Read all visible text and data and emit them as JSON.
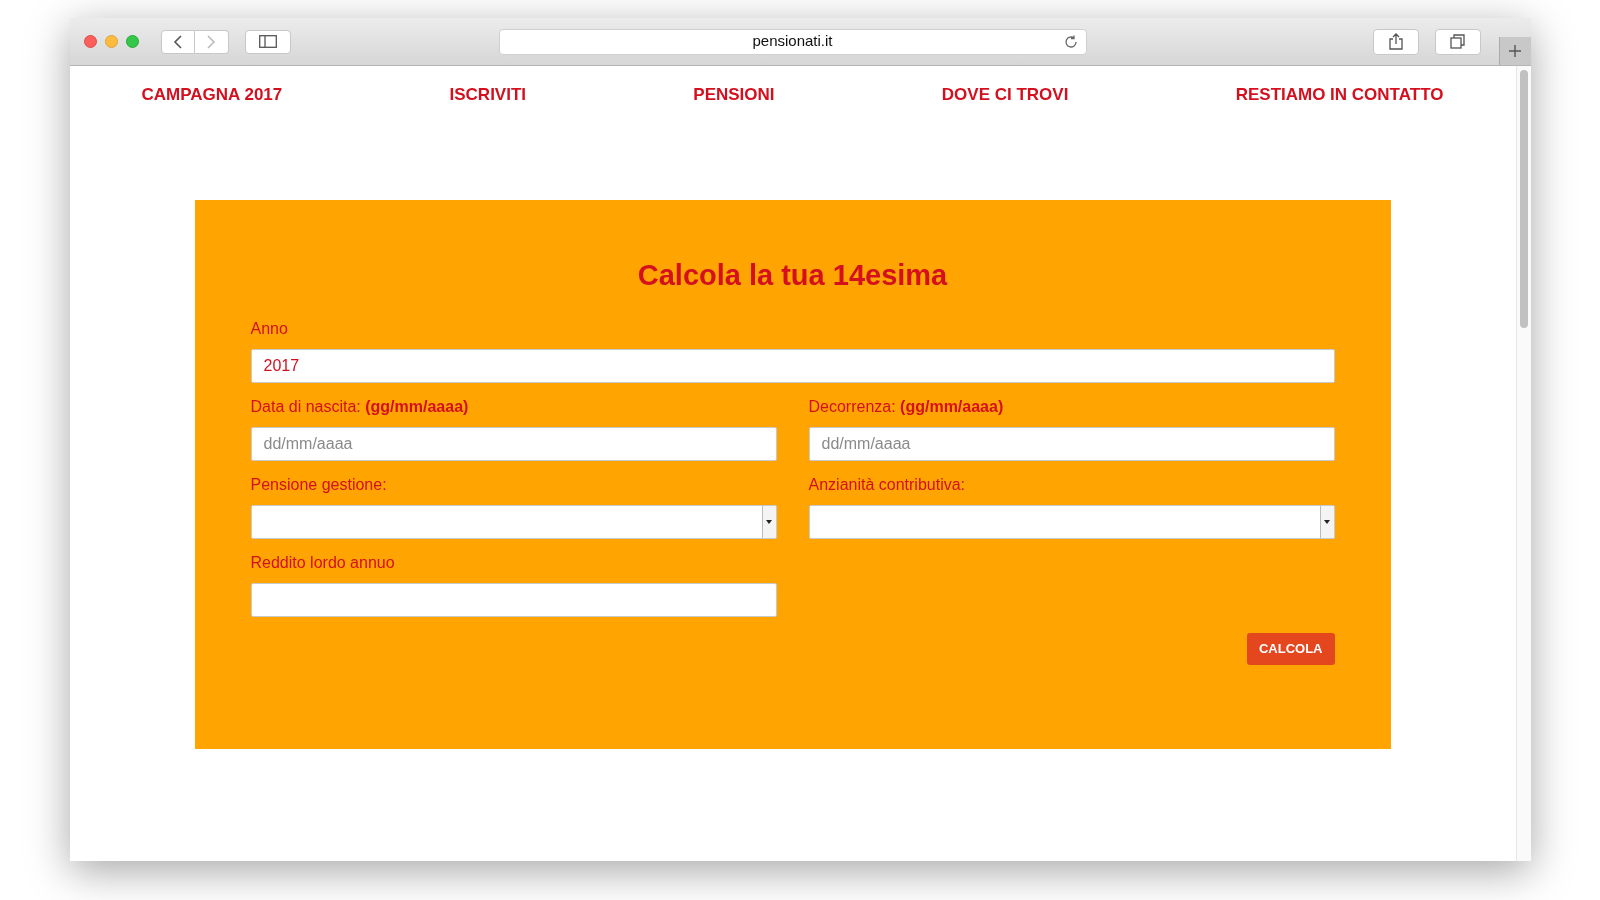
{
  "browser": {
    "url": "pensionati.it"
  },
  "nav": [
    "CAMPAGNA 2017",
    "ISCRIVITI",
    "PENSIONI",
    "DOVE CI TROVI",
    "RESTIAMO IN CONTATTO"
  ],
  "form": {
    "title": "Calcola la tua 14esima",
    "rows": [
      [
        {
          "kind": "text",
          "label": "Anno",
          "value": "2017"
        }
      ],
      [
        {
          "kind": "text",
          "label": "Data di nascita: **(gg/mm/aaaa)**",
          "placeholder": "dd/mm/aaaa"
        },
        {
          "kind": "text",
          "label": "Decorrenza: **(gg/mm/aaaa)**",
          "placeholder": "dd/mm/aaaa"
        }
      ],
      [
        {
          "kind": "select",
          "label": "Pensione gestione:"
        },
        {
          "kind": "select",
          "label": "Anzianità contributiva:"
        }
      ],
      [
        {
          "kind": "text",
          "label": "Reddito lordo annuo"
        }
      ]
    ],
    "button": "CALCOLA"
  }
}
